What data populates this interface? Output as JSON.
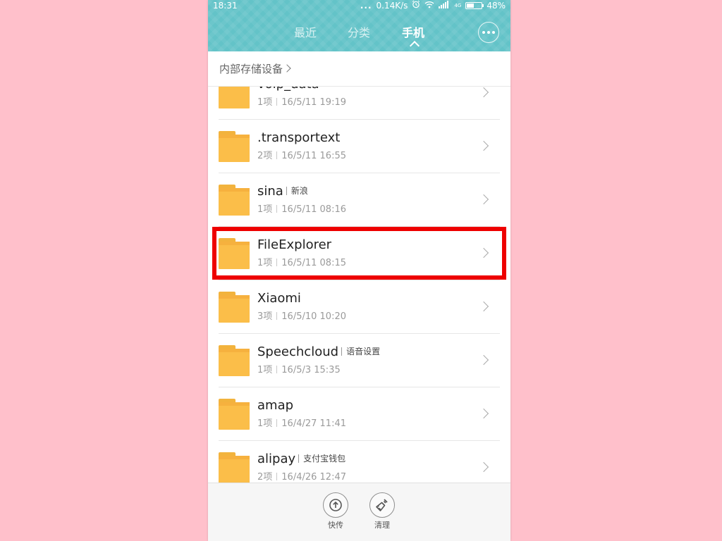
{
  "status_bar": {
    "time": "18:31",
    "dots": "...",
    "speed": "0.14K/s",
    "network": "4G",
    "battery_text": "48%",
    "battery_level": 0.48
  },
  "header": {
    "tabs": [
      {
        "label": "最近"
      },
      {
        "label": "分类"
      },
      {
        "label": "手机",
        "active": true
      }
    ]
  },
  "breadcrumb": {
    "label": "内部存储设备"
  },
  "folders": [
    {
      "name": "voip_data",
      "tag": "",
      "count": "1项",
      "date": "16/5/11 19:19"
    },
    {
      "name": ".transportext",
      "tag": "",
      "count": "2项",
      "date": "16/5/11 16:55"
    },
    {
      "name": "sina",
      "tag": "新浪",
      "count": "1项",
      "date": "16/5/11 08:16"
    },
    {
      "name": "FileExplorer",
      "tag": "",
      "count": "1项",
      "date": "16/5/11 08:15"
    },
    {
      "name": "Xiaomi",
      "tag": "",
      "count": "3项",
      "date": "16/5/10 10:20"
    },
    {
      "name": "Speechcloud",
      "tag": "语音设置",
      "count": "1项",
      "date": "16/5/3 15:35"
    },
    {
      "name": "amap",
      "tag": "",
      "count": "1项",
      "date": "16/4/27 11:41"
    },
    {
      "name": "alipay",
      "tag": "支付宝钱包",
      "count": "2项",
      "date": "16/4/26 12:47"
    }
  ],
  "bottom_bar": {
    "share_label": "快传",
    "clean_label": "清理"
  },
  "colors": {
    "accent": "#63c3c8",
    "folder": "#fbbe49",
    "highlight": "#ee0000",
    "background": "#ffc0cb"
  },
  "icons": [
    "alarm-icon",
    "wifi-icon",
    "signal-icon",
    "battery-icon",
    "more-icon",
    "folder-icon",
    "chevron-right-icon",
    "upload-icon",
    "broom-icon"
  ]
}
